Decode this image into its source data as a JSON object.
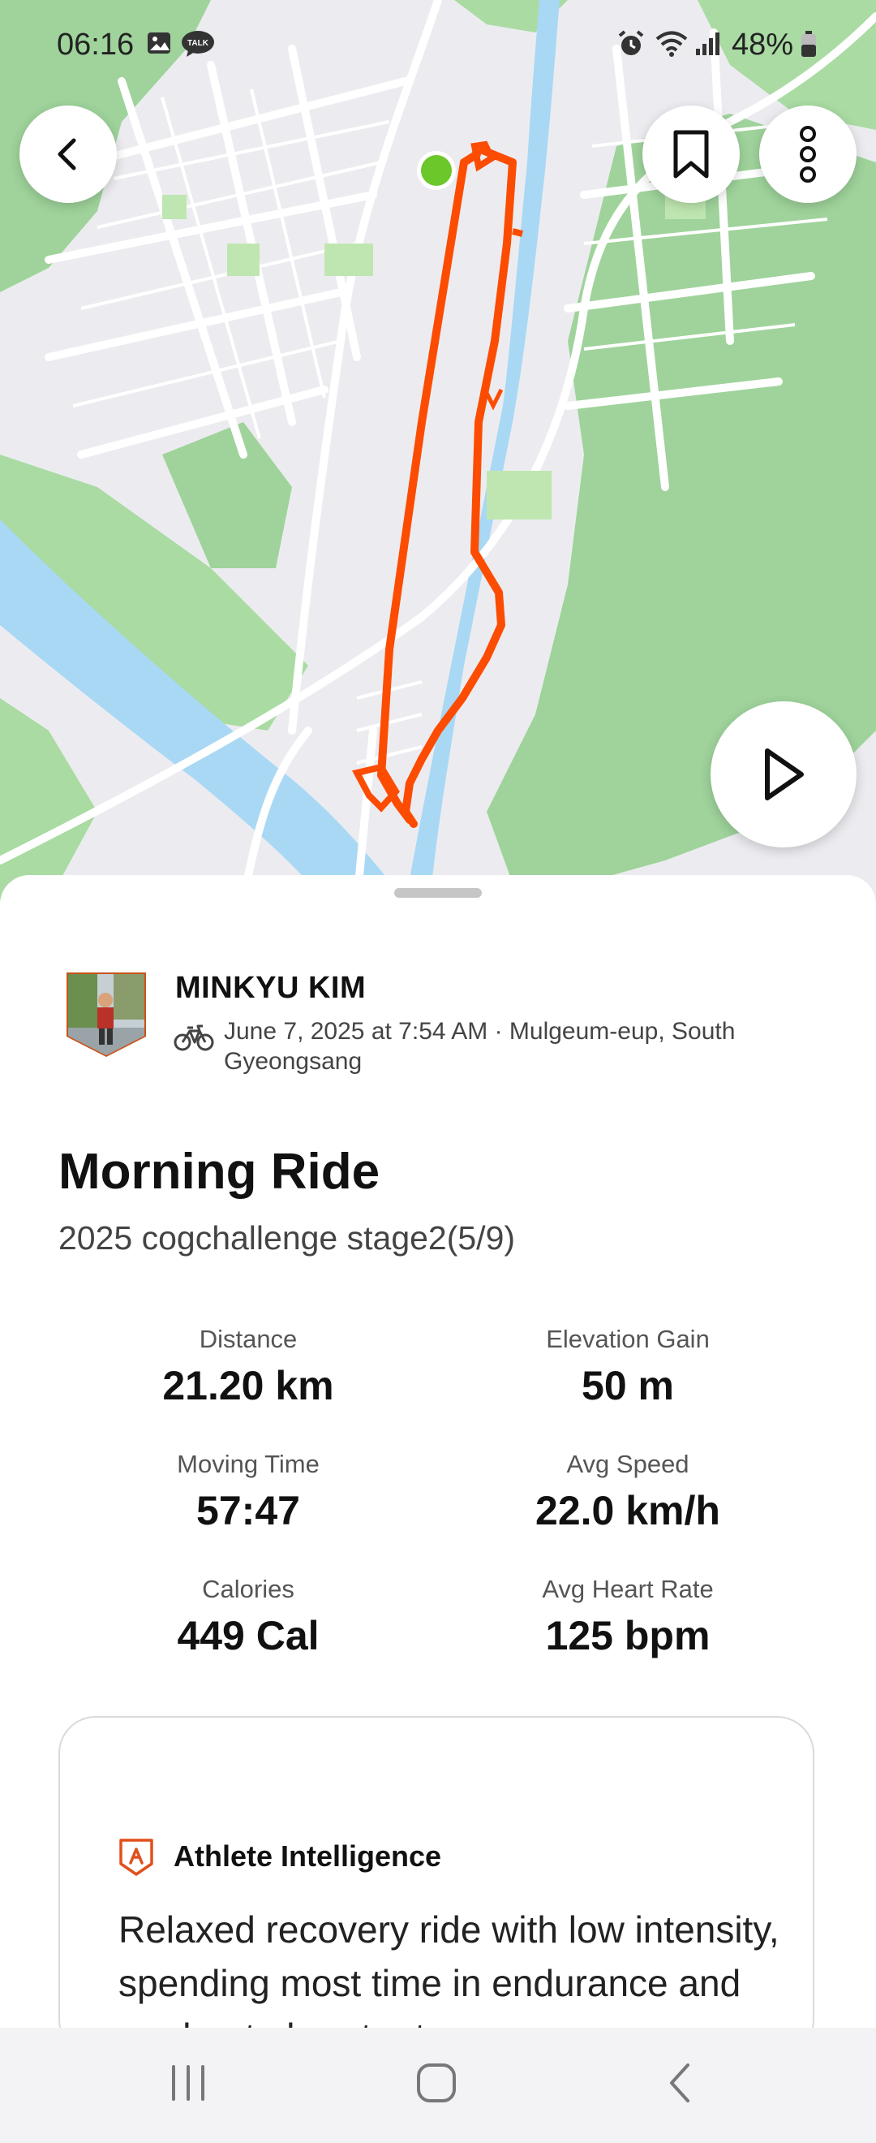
{
  "status_bar": {
    "time": "06:16",
    "battery": "48%",
    "icons": [
      "gallery-icon",
      "talk-icon",
      "alarm-icon",
      "wifi-icon",
      "signal-icon",
      "battery-icon"
    ]
  },
  "map": {
    "route_color": "#fc4c02",
    "start_marker_color": "#6cc72a",
    "buttons": [
      "back-icon",
      "bookmark-icon",
      "more-icon",
      "play-icon"
    ]
  },
  "activity": {
    "athlete_name": "MINKYU KIM",
    "meta": "June 7, 2025 at 7:54 AM · Mulgeum-eup, South Gyeongsang",
    "title": "Morning Ride",
    "description": "2025 cogchallenge stage2(5/9)"
  },
  "stats": {
    "distance": {
      "label": "Distance",
      "value": "21.20 km"
    },
    "elevation": {
      "label": "Elevation Gain",
      "value": "50 m"
    },
    "moving_time": {
      "label": "Moving Time",
      "value": "57:47"
    },
    "avg_speed": {
      "label": "Avg Speed",
      "value": "22.0 km/h"
    },
    "calories": {
      "label": "Calories",
      "value": "449 Cal"
    },
    "avg_hr": {
      "label": "Avg Heart Rate",
      "value": "125 bpm"
    }
  },
  "athlete_intelligence": {
    "title": "Athlete Intelligence",
    "text": "Relaxed recovery ride with low intensity, spending most time in endurance and moderate heart rate zones."
  },
  "colors": {
    "accent": "#fc4c02",
    "map_green": "#b9e3a9",
    "water": "#a9d8f5"
  }
}
